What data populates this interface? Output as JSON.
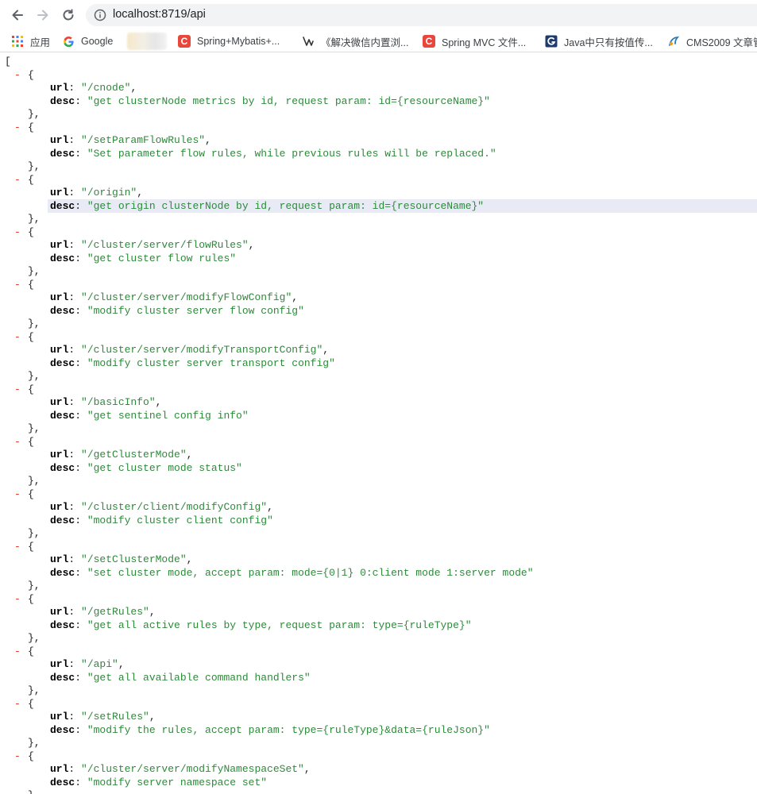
{
  "browser": {
    "url": "localhost:8719/api",
    "bookmarks": [
      {
        "icon": "apps-grid-icon",
        "label": "应用"
      },
      {
        "icon": "google-icon",
        "label": "Google"
      },
      {
        "icon": "blurred-favicon",
        "label": ""
      },
      {
        "icon": "csdn-icon",
        "label": "Spring+Mybatis+..."
      },
      {
        "icon": "weixin-tool-icon",
        "label": "《解决微信内置浏..."
      },
      {
        "icon": "csdn-icon",
        "label": "Spring MVC 文件..."
      },
      {
        "icon": "blog-g-icon",
        "label": "Java中只有按值传..."
      },
      {
        "icon": "cms-icon",
        "label": "CMS2009 文章管"
      }
    ]
  },
  "json": {
    "open_bracket": "[",
    "url_key": "url",
    "desc_key": "desc",
    "collapse_glyph": "-",
    "items": [
      {
        "url": "\"/cnode\"",
        "desc": "\"get clusterNode metrics by id, request param: id={resourceName}\""
      },
      {
        "url": "\"/setParamFlowRules\"",
        "desc": "\"Set parameter flow rules, while previous rules will be replaced.\""
      },
      {
        "url": "\"/origin\"",
        "desc": "\"get origin clusterNode by id, request param: id={resourceName}\""
      },
      {
        "url": "\"/cluster/server/flowRules\"",
        "desc": "\"get cluster flow rules\""
      },
      {
        "url": "\"/cluster/server/modifyFlowConfig\"",
        "desc": "\"modify cluster server flow config\""
      },
      {
        "url": "\"/cluster/server/modifyTransportConfig\"",
        "desc": "\"modify cluster server transport config\""
      },
      {
        "url": "\"/basicInfo\"",
        "desc": "\"get sentinel config info\""
      },
      {
        "url": "\"/getClusterMode\"",
        "desc": "\"get cluster mode status\""
      },
      {
        "url": "\"/cluster/client/modifyConfig\"",
        "desc": "\"modify cluster client config\""
      },
      {
        "url": "\"/setClusterMode\"",
        "desc": "\"set cluster mode, accept param: mode={0|1} 0:client mode 1:server mode\""
      },
      {
        "url": "\"/getRules\"",
        "desc": "\"get all active rules by type, request param: type={ruleType}\""
      },
      {
        "url": "\"/api\"",
        "desc": "\"get all available command handlers\""
      },
      {
        "url": "\"/setRules\"",
        "desc": "\"modify the rules, accept param: type={ruleType}&data={ruleJson}\""
      },
      {
        "url": "\"/cluster/server/modifyNamespaceSet\"",
        "desc": "\"modify server namespace set\""
      }
    ]
  }
}
